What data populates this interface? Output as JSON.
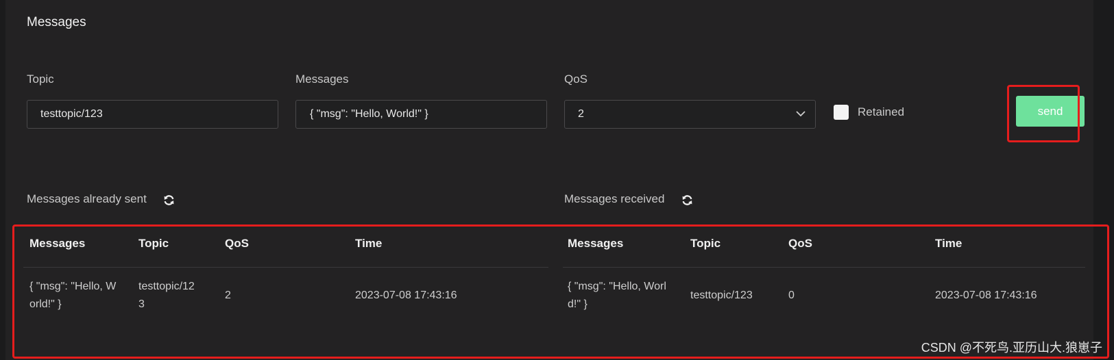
{
  "page": {
    "title": "Messages"
  },
  "form": {
    "topic_label": "Topic",
    "topic_value": "testtopic/123",
    "messages_label": "Messages",
    "messages_value": "{ \"msg\": \"Hello, World!\" }",
    "qos_label": "QoS",
    "qos_value": "2",
    "retained_label": "Retained",
    "retained_checked": false,
    "send_label": "send"
  },
  "sent": {
    "title": "Messages already sent",
    "columns": [
      "Messages",
      "Topic",
      "QoS",
      "Time"
    ],
    "rows": [
      {
        "message_line1": "{ \"msg\": \"Hello, W",
        "message_line2": "orld!\" }",
        "topic_line1": "testtopic/12",
        "topic_line2": "3",
        "qos": "2",
        "time": "2023-07-08 17:43:16"
      }
    ]
  },
  "received": {
    "title": "Messages received",
    "columns": [
      "Messages",
      "Topic",
      "QoS",
      "Time"
    ],
    "rows": [
      {
        "message_line1": "{ \"msg\": \"Hello, Worl",
        "message_line2": "d!\" }",
        "topic": "testtopic/123",
        "qos": "0",
        "time": "2023-07-08 17:43:16"
      }
    ]
  },
  "icons": {
    "refresh": "refresh-icon",
    "dropdown": "chevron-down-icon"
  },
  "watermark": "CSDN @不死鸟.亚历山大.狼崽子",
  "colors": {
    "background": "#1b1b1c",
    "panel": "#232223",
    "accent": "#6ee19c",
    "highlight": "#e51d1d"
  }
}
